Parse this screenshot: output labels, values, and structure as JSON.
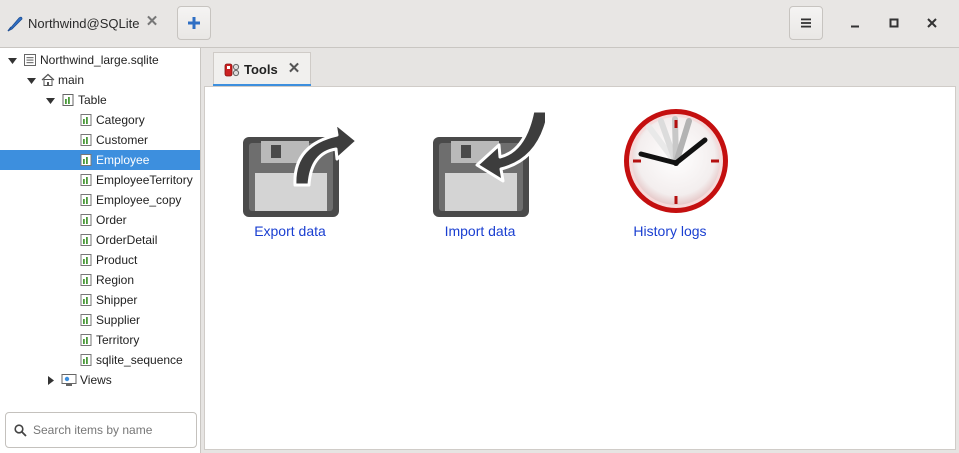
{
  "window": {
    "tab_title": "Northwind@SQLite",
    "icons": {
      "app": "feather-icon",
      "close": "close-icon",
      "add": "plus-icon",
      "menu": "hamburger-menu-icon",
      "minimize": "minimize-icon",
      "maximize": "maximize-icon",
      "window_close": "window-close-icon"
    },
    "accent_color": "#3d8fde"
  },
  "sidebar": {
    "tree": {
      "database": "Northwind_large.sqlite",
      "schema": "main",
      "table_group": "Table",
      "tables": [
        "Category",
        "Customer",
        "Employee",
        "EmployeeTerritory",
        "Employee_copy",
        "Order",
        "OrderDetail",
        "Product",
        "Region",
        "Shipper",
        "Supplier",
        "Territory",
        "sqlite_sequence"
      ],
      "selected_table": "Employee",
      "views_group": "Views"
    },
    "search": {
      "placeholder": "Search items by name",
      "value": ""
    }
  },
  "main": {
    "tabs": [
      {
        "label": "Tools",
        "active": true
      }
    ],
    "tools": [
      {
        "label": "Export data",
        "icon": "floppy-export-icon"
      },
      {
        "label": "Import data",
        "icon": "floppy-import-icon"
      },
      {
        "label": "History logs",
        "icon": "clock-icon"
      }
    ],
    "link_color": "#1a3fd1"
  }
}
